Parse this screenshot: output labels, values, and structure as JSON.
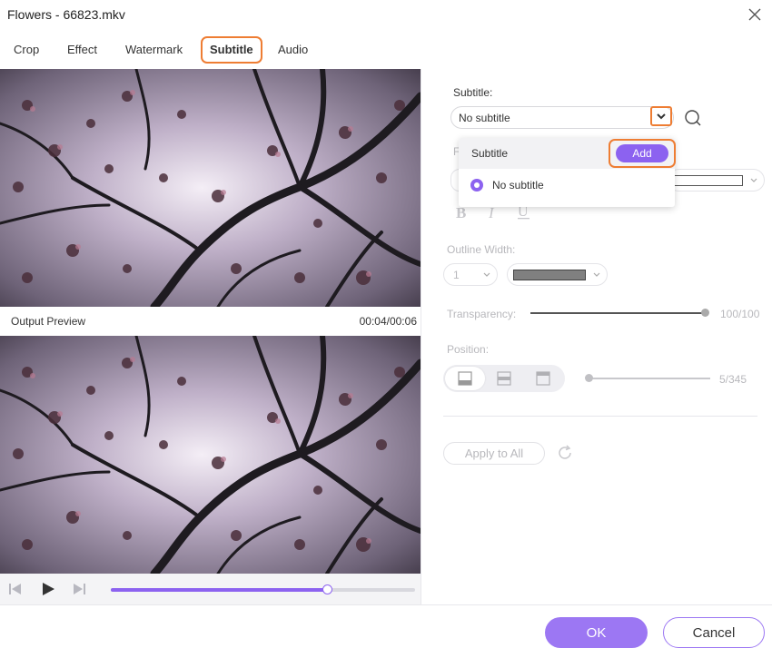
{
  "window": {
    "title": "Flowers - 66823.mkv"
  },
  "tabs": [
    {
      "label": "Crop"
    },
    {
      "label": "Effect"
    },
    {
      "label": "Watermark"
    },
    {
      "label": "Subtitle"
    },
    {
      "label": "Audio"
    }
  ],
  "active_tab": "Subtitle",
  "preview": {
    "output_label": "Output Preview",
    "time": "00:04/00:06",
    "playback_progress_fraction": 0.71
  },
  "subtitle_panel": {
    "subtitle_label": "Subtitle:",
    "subtitle_value": "No subtitle",
    "dropdown": {
      "header": "Subtitle",
      "add_label": "Add",
      "options": [
        {
          "label": "No subtitle",
          "selected": true
        }
      ]
    },
    "outline_width_label": "Outline Width:",
    "outline_width_value": "1",
    "outline_color": "#808080",
    "transparency_label": "Transparency:",
    "transparency_value": "100/100",
    "position_label": "Position:",
    "position_value": "5/345",
    "apply_all_label": "Apply to All"
  },
  "footer": {
    "ok_label": "OK",
    "cancel_label": "Cancel"
  },
  "colors": {
    "accent": "#8c62f0",
    "highlight": "#ee7d33"
  },
  "icons": [
    "close-icon",
    "search-icon",
    "chevron-down-icon",
    "bold-icon",
    "italic-icon",
    "underline-icon",
    "refresh-icon",
    "prev-frame-icon",
    "play-icon",
    "next-frame-icon"
  ]
}
